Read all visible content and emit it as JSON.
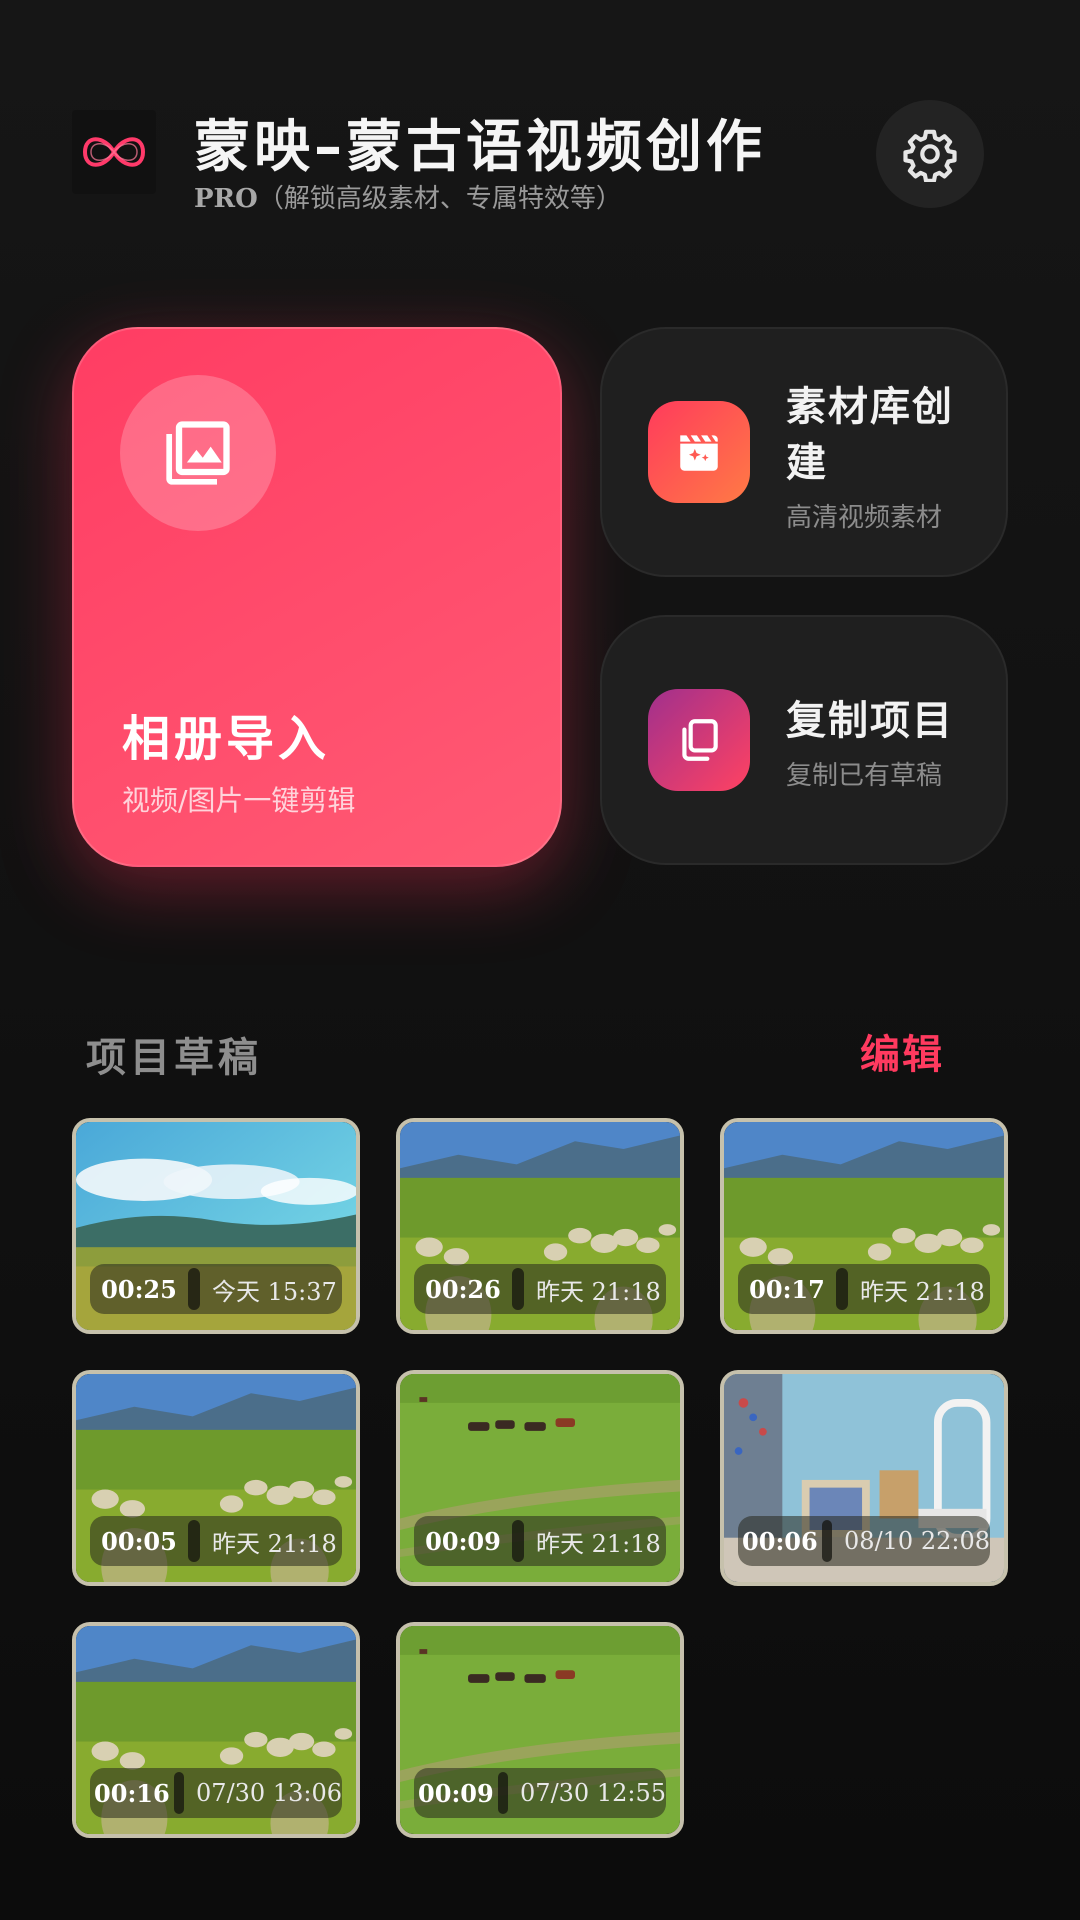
{
  "header": {
    "title": "蒙映–蒙古语视频创作",
    "pro_label": "PRO",
    "subtitle": "（解锁高级素材、专属特效等）",
    "logo_icon": "infinity-logo-icon",
    "settings_icon": "gear-icon"
  },
  "import_card": {
    "title": "相册导入",
    "subtitle": "视频/图片一键剪辑",
    "icon": "photo-library-icon"
  },
  "side_cards": [
    {
      "title": "素材库创建",
      "subtitle": "高清视频素材",
      "icon": "clapperboard-sparkle-icon"
    },
    {
      "title": "复制项目",
      "subtitle": "复制已有草稿",
      "icon": "copy-icon"
    }
  ],
  "drafts": {
    "title": "项目草稿",
    "edit_label": "编辑",
    "items": [
      {
        "duration": "00:25",
        "date": "今天 15:37",
        "scene": "sky"
      },
      {
        "duration": "00:26",
        "date": "昨天 21:18",
        "scene": "sheep"
      },
      {
        "duration": "00:17",
        "date": "昨天 21:18",
        "scene": "sheep"
      },
      {
        "duration": "00:05",
        "date": "昨天 21:18",
        "scene": "sheep"
      },
      {
        "duration": "00:09",
        "date": "昨天 21:18",
        "scene": "horses"
      },
      {
        "duration": "00:06",
        "date": "08/10 22:08",
        "scene": "room"
      },
      {
        "duration": "00:16",
        "date": "07/30 13:06",
        "scene": "sheep"
      },
      {
        "duration": "00:09",
        "date": "07/30 12:55",
        "scene": "horses"
      }
    ]
  },
  "colors": {
    "accent": "#ff3a5f",
    "background": "#121212",
    "card": "#1f1f1f"
  }
}
